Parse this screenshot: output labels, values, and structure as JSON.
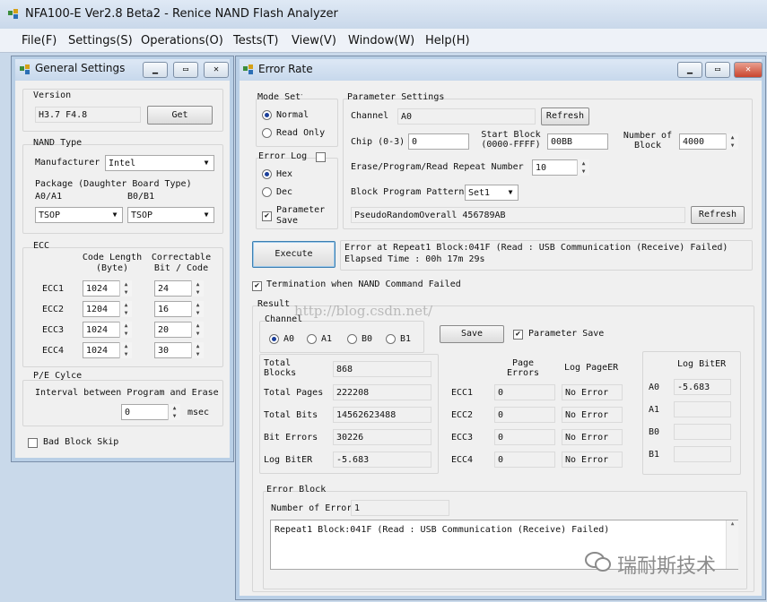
{
  "app": {
    "title": "NFA100-E Ver2.8 Beta2 - Renice NAND Flash Analyzer"
  },
  "menu": [
    "File(F)",
    "Settings(S)",
    "Operations(O)",
    "Tests(T)",
    "View(V)",
    "Window(W)",
    "Help(H)"
  ],
  "general": {
    "title": "General Settings",
    "version_label": "Version",
    "version_value": "H3.7 F4.8",
    "get_btn": "Get",
    "nand_type_label": "NAND Type",
    "manufacturer_label": "Manufacturer",
    "manufacturer_value": "Intel",
    "package_label": "Package (Daughter Board Type)",
    "a0a1_label": "A0/A1",
    "b0b1_label": "B0/B1",
    "a0a1_value": "TSOP",
    "b0b1_value": "TSOP",
    "ecc_label": "ECC",
    "code_len_header": "Code Length\n(Byte)",
    "correctable_header": "Correctable\nBit / Code",
    "ecc_rows": [
      {
        "name": "ECC1",
        "len": "1024",
        "bits": "24"
      },
      {
        "name": "ECC2",
        "len": "1204",
        "bits": "16"
      },
      {
        "name": "ECC3",
        "len": "1024",
        "bits": "20"
      },
      {
        "name": "ECC4",
        "len": "1024",
        "bits": "30"
      }
    ],
    "pe_label": "P/E Cylce",
    "interval_label": "Interval between Program and Erase",
    "interval_value": "0",
    "msec": "msec",
    "bad_block_label": "Bad Block Skip"
  },
  "error_rate": {
    "title": "Error Rate",
    "mode_label": "Mode Setting",
    "normal": "Normal",
    "read_only": "Read Only",
    "error_log_label": "Error Log",
    "hex": "Hex",
    "dec": "Dec",
    "param_save": "Parameter Save",
    "params_label": "Parameter Settings",
    "channel_label": "Channel",
    "channel_value": "A0",
    "refresh": "Refresh",
    "chip_label": "Chip (0-3)",
    "chip_value": "0",
    "start_block_label": "Start Block\n(0000-FFFF)",
    "start_block_value": "00BB",
    "num_block_label": "Number of\nBlock",
    "num_block_value": "4000",
    "repeat_label": "Erase/Program/Read Repeat Number",
    "repeat_value": "10",
    "pattern_label": "Block Program Pattern",
    "pattern_value": "Set1",
    "pattern_desc": "PseudoRandomOverall 456789AB",
    "refresh2": "Refresh",
    "execute": "Execute",
    "status_line1": "Error at Repeat1 Block:041F (Read : USB Communication (Receive) Failed)",
    "status_line2": "Elapsed Time : 00h 17m 29s",
    "termination": "Termination when NAND Command Failed",
    "result_label": "Result",
    "channel_group": "Channel",
    "channels": [
      "A0",
      "A1",
      "B0",
      "B1"
    ],
    "save": "Save",
    "result_param_save": "Parameter Save",
    "stats": [
      {
        "label": "Total\nBlocks",
        "value": "868"
      },
      {
        "label": "Total Pages",
        "value": "222208"
      },
      {
        "label": "Total Bits",
        "value": "14562623488"
      },
      {
        "label": "Bit Errors",
        "value": "30226"
      },
      {
        "label": "Log BitER",
        "value": "-5.683"
      }
    ],
    "page_errors_header": "Page\nErrors",
    "log_pageer_header": "Log PageER",
    "ecc_rows": [
      {
        "name": "ECC1",
        "errors": "0",
        "log": "No Error"
      },
      {
        "name": "ECC2",
        "errors": "0",
        "log": "No Error"
      },
      {
        "name": "ECC3",
        "errors": "0",
        "log": "No Error"
      },
      {
        "name": "ECC4",
        "errors": "0",
        "log": "No Error"
      }
    ],
    "log_biter_header": "Log BitER",
    "log_biter_rows": [
      {
        "name": "A0",
        "value": "-5.683"
      },
      {
        "name": "A1",
        "value": ""
      },
      {
        "name": "B0",
        "value": ""
      },
      {
        "name": "B1",
        "value": ""
      }
    ],
    "error_block_label": "Error Block",
    "num_error_label": "Number of Error",
    "num_error_value": "1",
    "error_entry": "Repeat1 Block:041F (Read : USB Communication (Receive) Failed)"
  },
  "watermark": {
    "url": "http://blog.csdn.net/",
    "brand": "瑞耐斯技术"
  }
}
